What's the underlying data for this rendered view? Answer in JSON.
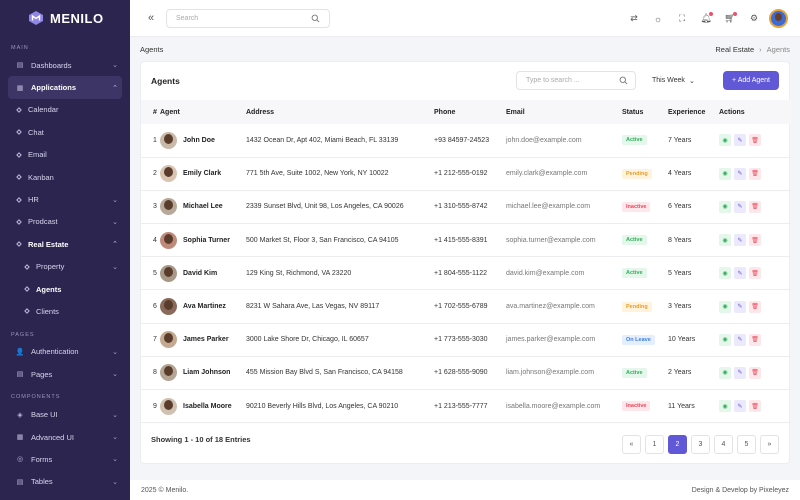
{
  "brand": {
    "name": "MENILO"
  },
  "sidebar": {
    "sections": {
      "main": "MAIN",
      "pages": "PAGES",
      "components": "COMPONENTS"
    },
    "items": [
      {
        "label": "Dashboards"
      },
      {
        "label": "Applications"
      },
      {
        "label": "Calendar"
      },
      {
        "label": "Chat"
      },
      {
        "label": "Email"
      },
      {
        "label": "Kanban"
      },
      {
        "label": "HR"
      },
      {
        "label": "Prodcast"
      },
      {
        "label": "Real Estate"
      },
      {
        "label": "Property"
      },
      {
        "label": "Agents"
      },
      {
        "label": "Clients"
      },
      {
        "label": "Authentication"
      },
      {
        "label": "Pages"
      },
      {
        "label": "Base UI"
      },
      {
        "label": "Advanced UI"
      },
      {
        "label": "Forms"
      },
      {
        "label": "Tables"
      }
    ]
  },
  "topbar": {
    "search_placeholder": "Search"
  },
  "breadcrumb": {
    "page": "Agents",
    "parent": "Real Estate",
    "separator": "›",
    "current": "Agents"
  },
  "card": {
    "title": "Agents",
    "search_placeholder": "Type to search ...",
    "period": "This Week",
    "add_label": "+ Add Agent"
  },
  "table": {
    "headers": [
      "#",
      "Agent",
      "Address",
      "Phone",
      "Email",
      "Status",
      "Experience",
      "Actions"
    ],
    "rows": [
      {
        "num": "1",
        "name": "John Doe",
        "address": "1432 Ocean Dr, Apt 402, Miami Beach, FL 33139",
        "phone": "+93 84597-24523",
        "email": "john.doe@example.com",
        "status": "Active",
        "exp": "7 Years"
      },
      {
        "num": "2",
        "name": "Emily Clark",
        "address": "771 5th Ave, Suite 1002, New York, NY 10022",
        "phone": "+1 212-555-0192",
        "email": "emily.clark@example.com",
        "status": "Pending",
        "exp": "4 Years"
      },
      {
        "num": "3",
        "name": "Michael Lee",
        "address": "2339 Sunset Blvd, Unit 98, Los Angeles, CA 90026",
        "phone": "+1 310-555-8742",
        "email": "michael.lee@example.com",
        "status": "Inactive",
        "exp": "6 Years"
      },
      {
        "num": "4",
        "name": "Sophia Turner",
        "address": "500 Market St, Floor 3, San Francisco, CA 94105",
        "phone": "+1 415-555-8391",
        "email": "sophia.turner@example.com",
        "status": "Active",
        "exp": "8 Years"
      },
      {
        "num": "5",
        "name": "David Kim",
        "address": "129 King St, Richmond, VA 23220",
        "phone": "+1 804-555-1122",
        "email": "david.kim@example.com",
        "status": "Active",
        "exp": "5 Years"
      },
      {
        "num": "6",
        "name": "Ava Martinez",
        "address": "8231 W Sahara Ave, Las Vegas, NV 89117",
        "phone": "+1 702-555-6789",
        "email": "ava.martinez@example.com",
        "status": "Pending",
        "exp": "3 Years"
      },
      {
        "num": "7",
        "name": "James Parker",
        "address": "3000 Lake Shore Dr, Chicago, IL 60657",
        "phone": "+1 773-555-3030",
        "email": "james.parker@example.com",
        "status": "On Leave",
        "exp": "10 Years"
      },
      {
        "num": "8",
        "name": "Liam Johnson",
        "address": "455 Mission Bay Blvd S, San Francisco, CA 94158",
        "phone": "+1 628-555-9090",
        "email": "liam.johnson@example.com",
        "status": "Active",
        "exp": "2 Years"
      },
      {
        "num": "9",
        "name": "Isabella Moore",
        "address": "90210 Beverly Hills Blvd, Los Angeles, CA 90210",
        "phone": "+1 213-555-7777",
        "email": "isabella.moore@example.com",
        "status": "Inactive",
        "exp": "11 Years"
      }
    ]
  },
  "pagination": {
    "summary": "Showing 1 - 10 of 18 Entries",
    "pages": [
      "«",
      "1",
      "2",
      "3",
      "4",
      "5",
      "»"
    ],
    "current": "2"
  },
  "footer": {
    "left": "2025 © Menilo.",
    "right": "Design & Develop by Pixeleyez"
  },
  "colors": {
    "accent": "#6158d8",
    "sidebar": "#2b2550"
  }
}
